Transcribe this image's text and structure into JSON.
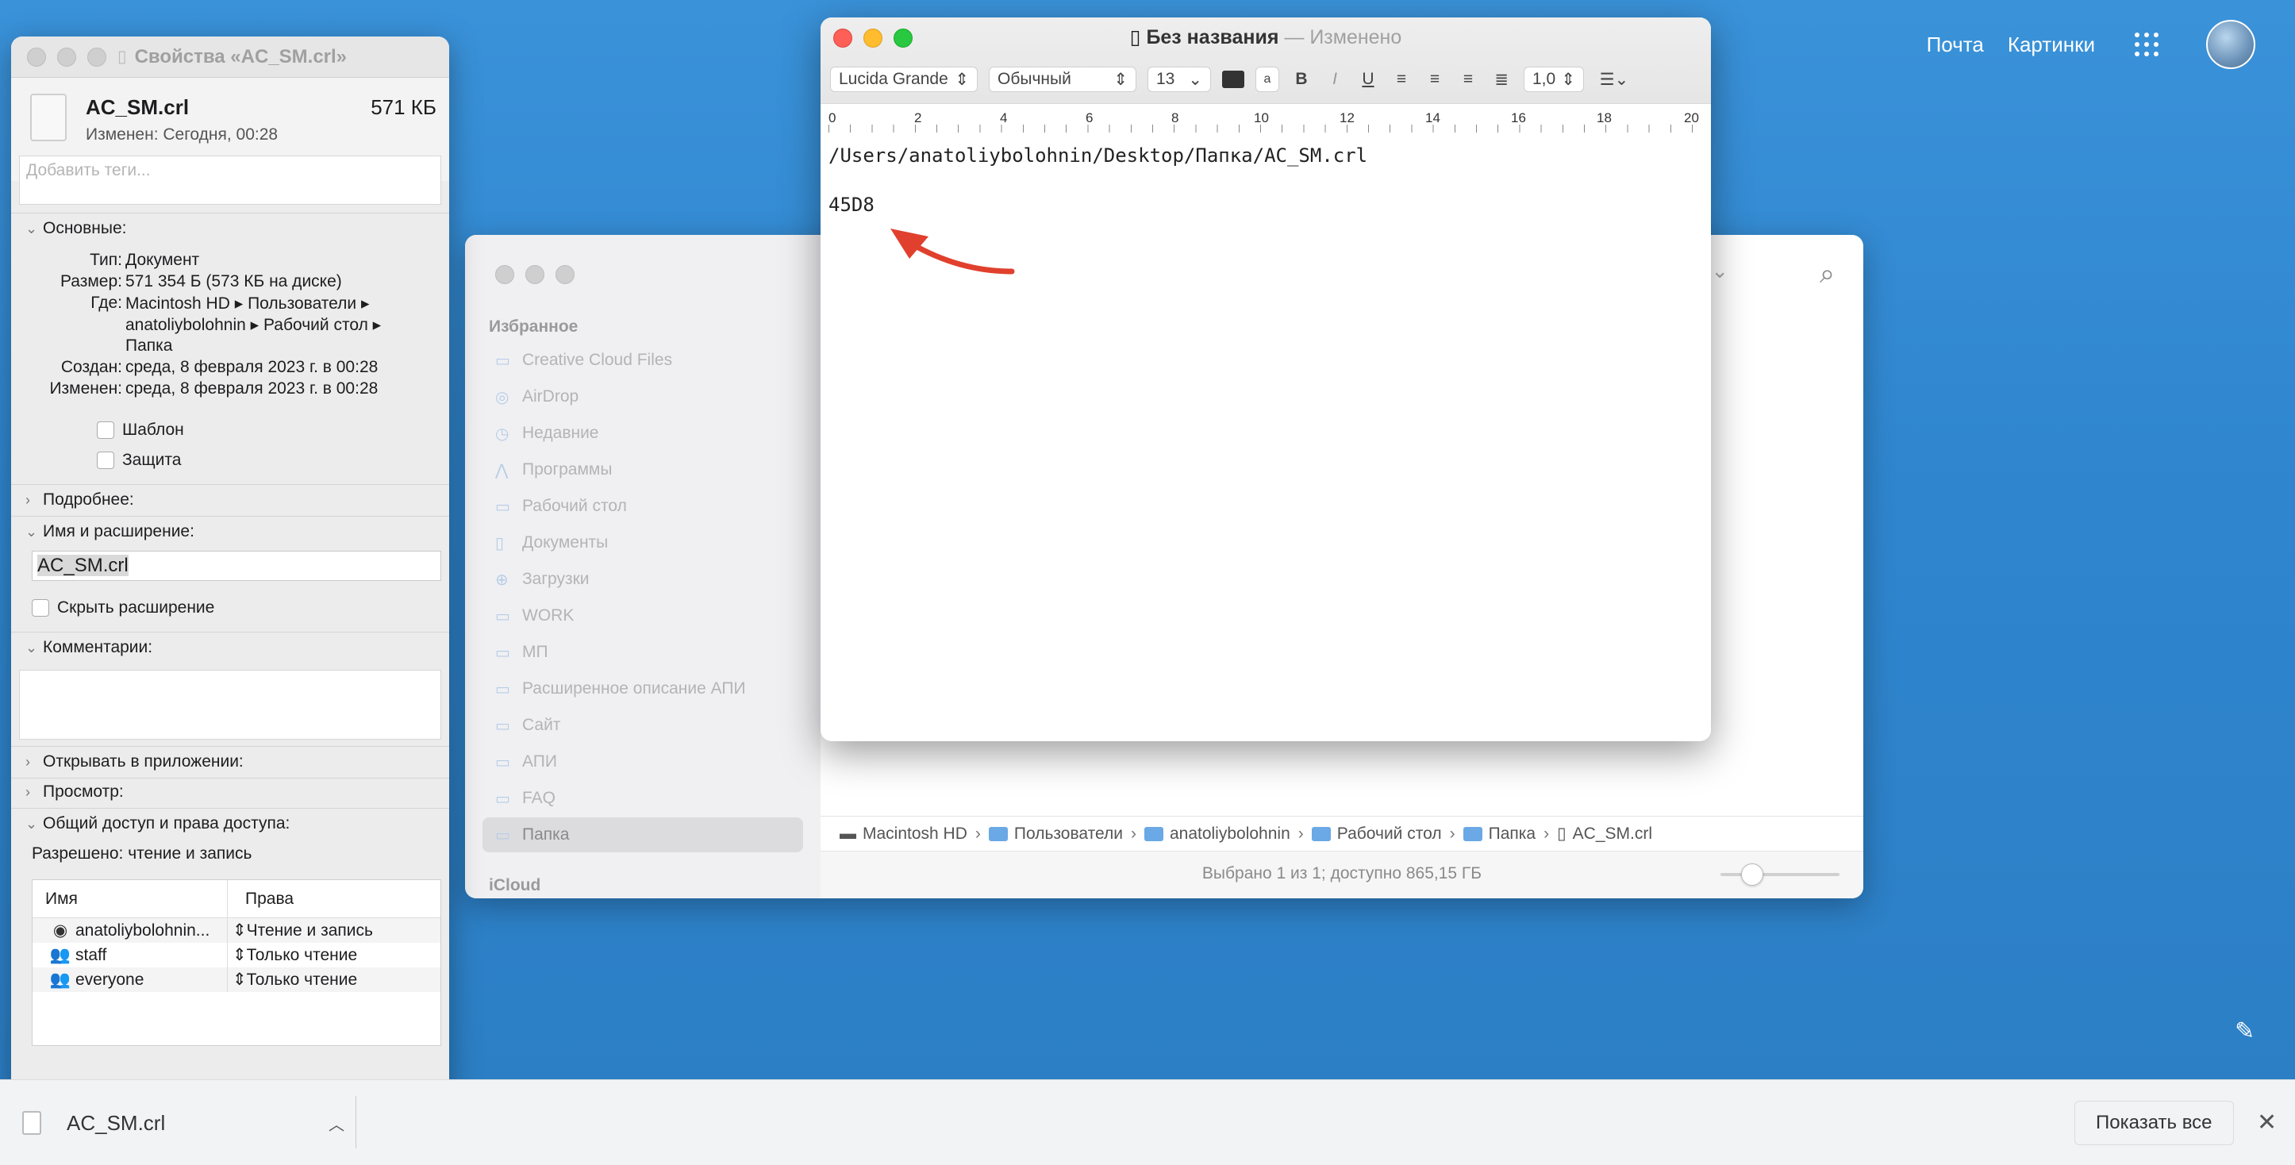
{
  "topnav": {
    "mail": "Почта",
    "images": "Картинки"
  },
  "info": {
    "title": "Свойства «AC_SM.crl»",
    "file_name": "AC_SM.crl",
    "file_size": "571 КБ",
    "modified_short": "Изменен: Сегодня, 00:28",
    "tags_placeholder": "Добавить теги...",
    "general": {
      "header": "Основные:",
      "kind_label": "Тип:",
      "kind": "Документ",
      "size_label": "Размер:",
      "size": "571 354 Б (573 КБ на диске)",
      "where_label": "Где:",
      "where_1": "Macintosh HD ▸ Пользователи ▸",
      "where_2": "anatoliybolohnin ▸ Рабочий стол ▸",
      "where_3": "Папка",
      "created_label": "Создан:",
      "created": "среда, 8 февраля 2023 г. в 00:28",
      "modified_label": "Изменен:",
      "modified": "среда, 8 февраля 2023 г. в 00:28",
      "stationery": "Шаблон",
      "locked": "Защита"
    },
    "more_info": "Подробнее:",
    "name_ext_header": "Имя и расширение:",
    "name_value": "AC_SM.crl",
    "hide_extension": "Скрыть расширение",
    "comments_header": "Комментарии:",
    "open_with": "Открывать в приложении:",
    "preview": "Просмотр:",
    "sharing_header": "Общий доступ и права доступа:",
    "sharing_status": "Разрешено: чтение и запись",
    "perm_headers": {
      "name": "Имя",
      "privilege": "Права"
    },
    "perm_rows": [
      {
        "name": "anatoliybolohnin...",
        "priv": "Чтение и запись"
      },
      {
        "name": "staff",
        "priv": "Только чтение"
      },
      {
        "name": "everyone",
        "priv": "Только чтение"
      }
    ]
  },
  "finder": {
    "sidebar_title": "Избранное",
    "items": [
      "Creative Cloud Files",
      "AirDrop",
      "Недавние",
      "Программы",
      "Рабочий стол",
      "Документы",
      "Загрузки",
      "WORK",
      "МП",
      "Расширенное описание АПИ",
      "Сайт",
      "АПИ",
      "FAQ",
      "Папка"
    ],
    "icloud": "iCloud",
    "path": [
      "Macintosh HD",
      "Пользователи",
      "anatoliybolohnin",
      "Рабочий стол",
      "Папка",
      "AC_SM.crl"
    ],
    "status": "Выбрано 1 из 1; доступно 865,15 ГБ"
  },
  "editor": {
    "title": "Без названия",
    "title_sep": "—",
    "edited": "Изменено",
    "font": "Lucida Grande",
    "style": "Обычный",
    "size": "13",
    "spacing": "1,0",
    "ruler": [
      "0",
      "2",
      "4",
      "6",
      "8",
      "10",
      "12",
      "14",
      "16",
      "18",
      "20"
    ],
    "line1": "/Users/anatoliybolohnin/Desktop/Папка/AC_SM.crl",
    "line2": "45D8"
  },
  "downloads": {
    "file": "AC_SM.crl",
    "show_all": "Показать все"
  }
}
